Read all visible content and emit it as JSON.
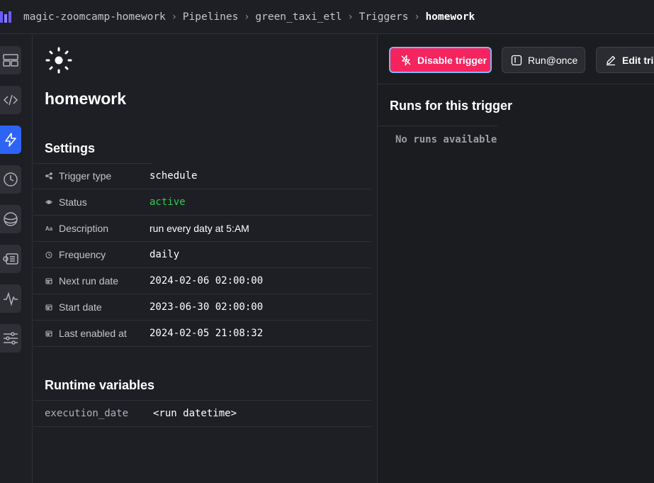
{
  "breadcrumb": [
    "magic-zoomcamp-homework",
    "Pipelines",
    "green_taxi_etl",
    "Triggers",
    "homework"
  ],
  "trigger": {
    "name": "homework"
  },
  "settings": {
    "title": "Settings",
    "rows": [
      {
        "icon": "share-icon",
        "label": "Trigger type",
        "value": "schedule"
      },
      {
        "icon": "status-icon",
        "label": "Status",
        "value": "active"
      },
      {
        "icon": "text-icon",
        "label": "Description",
        "value": "run every daty at 5:AM"
      },
      {
        "icon": "clock-icon",
        "label": "Frequency",
        "value": "daily"
      },
      {
        "icon": "calendar-icon",
        "label": "Next run date",
        "value": "2024-02-06 02:00:00"
      },
      {
        "icon": "calendar-icon",
        "label": "Start date",
        "value": "2023-06-30 02:00:00"
      },
      {
        "icon": "calendar-icon",
        "label": "Last enabled at",
        "value": "2024-02-05 21:08:32"
      }
    ]
  },
  "runtime_variables": {
    "title": "Runtime variables",
    "rows": [
      {
        "key": "execution_date",
        "value": "<run datetime>"
      }
    ]
  },
  "toolbar": {
    "disable_label": "Disable trigger",
    "run_once_label": "Run@once",
    "edit_label": "Edit trigger"
  },
  "runs": {
    "title": "Runs for this trigger",
    "empty_text": "No runs available"
  },
  "colors": {
    "accent_blue": "#2e64f6",
    "danger": "#f5245e",
    "status_active": "#2fcb52"
  }
}
